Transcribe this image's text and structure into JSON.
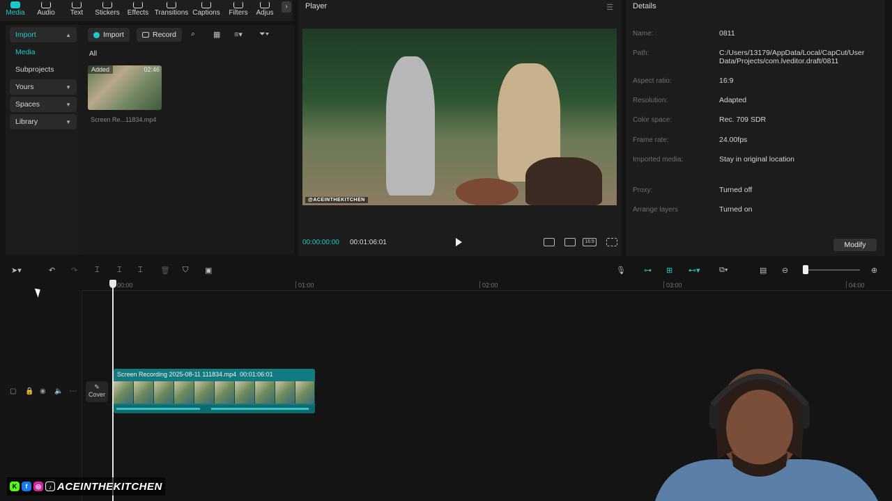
{
  "colors": {
    "accent": "#1ec8c8",
    "panel": "#1c1c1c",
    "background": "#141414",
    "clip": "#137a80"
  },
  "toolbar": {
    "tabs": [
      {
        "label": "Media",
        "icon": "media-icon",
        "active": true
      },
      {
        "label": "Audio",
        "icon": "audio-icon"
      },
      {
        "label": "Text",
        "icon": "text-icon"
      },
      {
        "label": "Stickers",
        "icon": "stickers-icon"
      },
      {
        "label": "Effects",
        "icon": "effects-icon"
      },
      {
        "label": "Transitions",
        "icon": "transitions-icon"
      },
      {
        "label": "Captions",
        "icon": "captions-icon"
      },
      {
        "label": "Filters",
        "icon": "filters-icon"
      },
      {
        "label": "Adjus",
        "icon": "adjust-icon"
      }
    ],
    "next_icon": "chevron-right-icon"
  },
  "sidebar": {
    "items": [
      {
        "label": "Import",
        "caret": "▲"
      },
      {
        "label": "Media"
      },
      {
        "label": "Subprojects"
      },
      {
        "label": "Yours",
        "caret": "▼"
      },
      {
        "label": "Spaces",
        "caret": "▼"
      },
      {
        "label": "Library",
        "caret": "▼"
      }
    ]
  },
  "media": {
    "import_label": "Import",
    "record_label": "Record",
    "filter_all": "All",
    "item": {
      "badge": "Added",
      "duration": "02:46",
      "name": "Screen Re...11834.mp4"
    }
  },
  "player": {
    "title": "Player",
    "timecode_current": "00:00:00:00",
    "timecode_total": "00:01:06:01",
    "watermark": "@ACEINTHEKITCHEN"
  },
  "details": {
    "title": "Details",
    "rows": [
      {
        "label": "Name:",
        "value": "0811"
      },
      {
        "label": "Path:",
        "value": "C:/Users/13179/AppData/Local/CapCut/User Data/Projects/com.lveditor.draft/0811"
      },
      {
        "label": "Aspect ratio:",
        "value": "16:9"
      },
      {
        "label": "Resolution:",
        "value": "Adapted"
      },
      {
        "label": "Color space:",
        "value": "Rec. 709 SDR"
      },
      {
        "label": "Frame rate:",
        "value": "24.00fps"
      },
      {
        "label": "Imported media:",
        "value": "Stay in original location"
      },
      {
        "label": "Proxy:",
        "value": "Turned off"
      },
      {
        "label": "Arrange layers",
        "value": "Turned on"
      }
    ],
    "modify_label": "Modify"
  },
  "timeline": {
    "ruler": [
      "00:00",
      "01:00",
      "02:00",
      "03:00",
      "04:00"
    ],
    "cover_label": "Cover",
    "clip": {
      "name": "Screen Recording 2025-08-11 111834.mp4",
      "duration": "00:01:06:01"
    }
  },
  "overlay": {
    "brand": "ACEINTHEKITCHEN"
  }
}
